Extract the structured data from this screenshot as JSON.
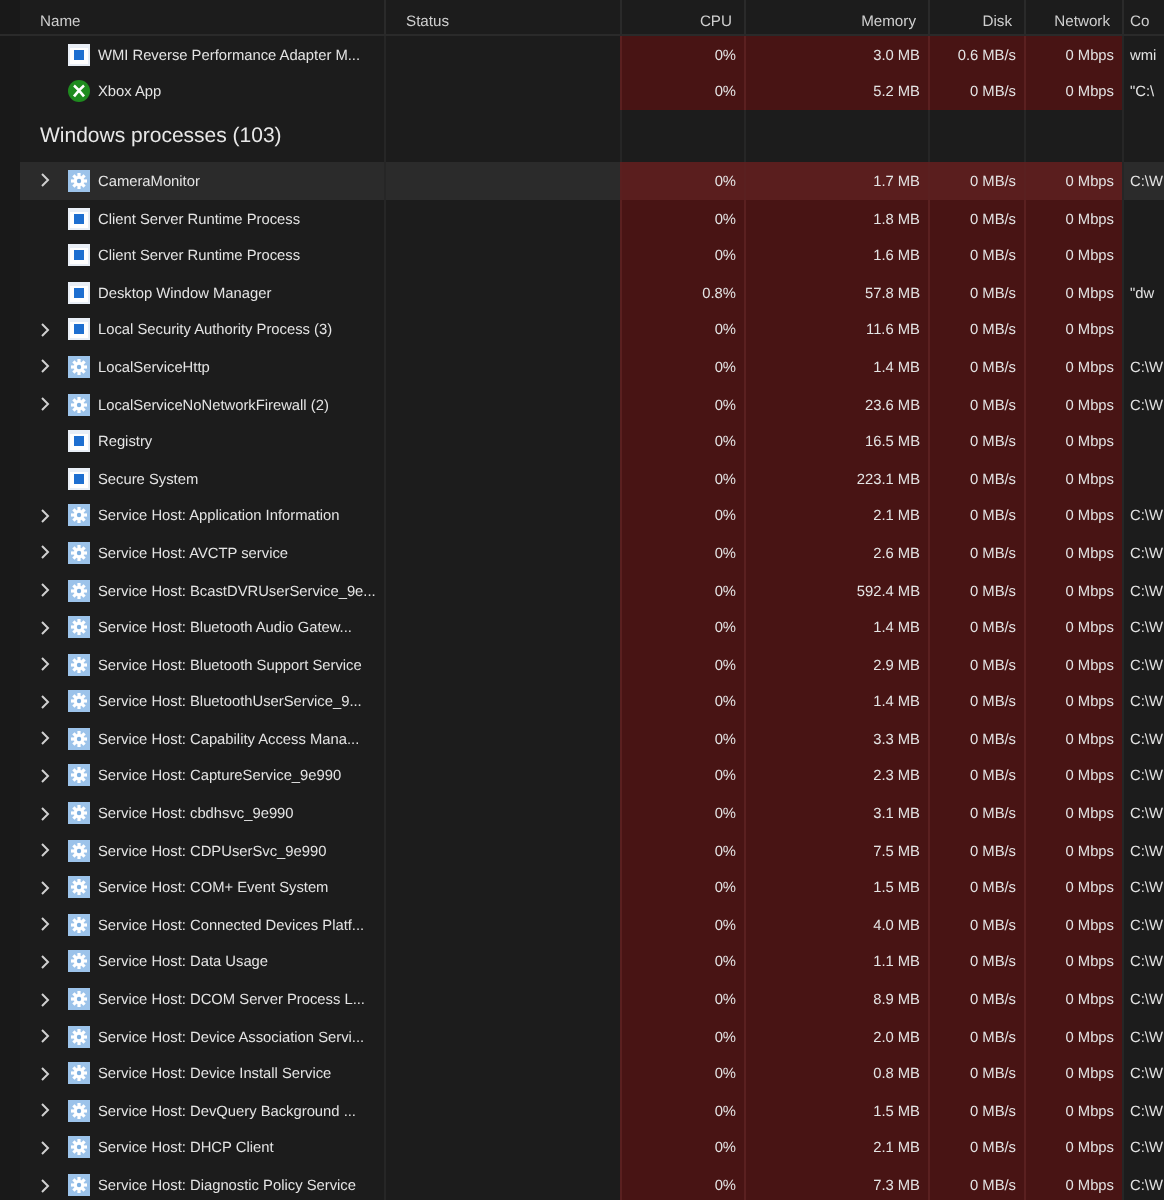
{
  "columns": [
    "Name",
    "Status",
    "CPU",
    "Memory",
    "Disk",
    "Network",
    "Co"
  ],
  "rows": [
    {
      "name": "WMI Reverse Performance Adapter M...",
      "kind": "window",
      "expandable": false,
      "selected": false,
      "cpu": "0%",
      "memory": "3.0 MB",
      "disk": "0.6 MB/s",
      "network": "0 Mbps",
      "command": "wmi"
    },
    {
      "name": "Xbox App",
      "kind": "xbox",
      "expandable": false,
      "selected": false,
      "cpu": "0%",
      "memory": "5.2 MB",
      "disk": "0 MB/s",
      "network": "0 Mbps",
      "command": "\"C:\\"
    }
  ],
  "windows_processes": {
    "heading": "Windows processes (103)",
    "rows": [
      {
        "name": "CameraMonitor",
        "kind": "gear",
        "expandable": true,
        "selected": true,
        "cpu": "0%",
        "memory": "1.7 MB",
        "disk": "0 MB/s",
        "network": "0 Mbps",
        "command": "C:\\W"
      },
      {
        "name": "Client Server Runtime Process",
        "kind": "window",
        "expandable": false,
        "selected": false,
        "cpu": "0%",
        "memory": "1.8 MB",
        "disk": "0 MB/s",
        "network": "0 Mbps"
      },
      {
        "name": "Client Server Runtime Process",
        "kind": "window",
        "expandable": false,
        "selected": false,
        "cpu": "0%",
        "memory": "1.6 MB",
        "disk": "0 MB/s",
        "network": "0 Mbps"
      },
      {
        "name": "Desktop Window Manager",
        "kind": "window",
        "expandable": false,
        "selected": false,
        "cpu": "0.8%",
        "memory": "57.8 MB",
        "disk": "0 MB/s",
        "network": "0 Mbps",
        "command": "\"dw"
      },
      {
        "name": "Local Security Authority Process (3)",
        "kind": "window",
        "expandable": true,
        "selected": false,
        "cpu": "0%",
        "memory": "11.6 MB",
        "disk": "0 MB/s",
        "network": "0 Mbps"
      },
      {
        "name": "LocalServiceHttp",
        "kind": "gear",
        "expandable": true,
        "selected": false,
        "cpu": "0%",
        "memory": "1.4 MB",
        "disk": "0 MB/s",
        "network": "0 Mbps",
        "command": "C:\\W"
      },
      {
        "name": "LocalServiceNoNetworkFirewall (2)",
        "kind": "gear",
        "expandable": true,
        "selected": false,
        "cpu": "0%",
        "memory": "23.6 MB",
        "disk": "0 MB/s",
        "network": "0 Mbps",
        "command": "C:\\W"
      },
      {
        "name": "Registry",
        "kind": "window",
        "expandable": false,
        "selected": false,
        "cpu": "0%",
        "memory": "16.5 MB",
        "disk": "0 MB/s",
        "network": "0 Mbps"
      },
      {
        "name": "Secure System",
        "kind": "window",
        "expandable": false,
        "selected": false,
        "cpu": "0%",
        "memory": "223.1 MB",
        "disk": "0 MB/s",
        "network": "0 Mbps"
      },
      {
        "name": "Service Host: Application Information",
        "kind": "gear",
        "expandable": true,
        "selected": false,
        "cpu": "0%",
        "memory": "2.1 MB",
        "disk": "0 MB/s",
        "network": "0 Mbps",
        "command": "C:\\W"
      },
      {
        "name": "Service Host: AVCTP service",
        "kind": "gear",
        "expandable": true,
        "selected": false,
        "cpu": "0%",
        "memory": "2.6 MB",
        "disk": "0 MB/s",
        "network": "0 Mbps",
        "command": "C:\\W"
      },
      {
        "name": "Service Host: BcastDVRUserService_9e...",
        "kind": "gear",
        "expandable": true,
        "selected": false,
        "cpu": "0%",
        "memory": "592.4 MB",
        "disk": "0 MB/s",
        "network": "0 Mbps",
        "command": "C:\\W"
      },
      {
        "name": "Service Host: Bluetooth Audio Gatew...",
        "kind": "gear",
        "expandable": true,
        "selected": false,
        "cpu": "0%",
        "memory": "1.4 MB",
        "disk": "0 MB/s",
        "network": "0 Mbps",
        "command": "C:\\W"
      },
      {
        "name": "Service Host: Bluetooth Support Service",
        "kind": "gear",
        "expandable": true,
        "selected": false,
        "cpu": "0%",
        "memory": "2.9 MB",
        "disk": "0 MB/s",
        "network": "0 Mbps",
        "command": "C:\\W"
      },
      {
        "name": "Service Host: BluetoothUserService_9...",
        "kind": "gear",
        "expandable": true,
        "selected": false,
        "cpu": "0%",
        "memory": "1.4 MB",
        "disk": "0 MB/s",
        "network": "0 Mbps",
        "command": "C:\\W"
      },
      {
        "name": "Service Host: Capability Access Mana...",
        "kind": "gear",
        "expandable": true,
        "selected": false,
        "cpu": "0%",
        "memory": "3.3 MB",
        "disk": "0 MB/s",
        "network": "0 Mbps",
        "command": "C:\\W"
      },
      {
        "name": "Service Host: CaptureService_9e990",
        "kind": "gear",
        "expandable": true,
        "selected": false,
        "cpu": "0%",
        "memory": "2.3 MB",
        "disk": "0 MB/s",
        "network": "0 Mbps",
        "command": "C:\\W"
      },
      {
        "name": "Service Host: cbdhsvc_9e990",
        "kind": "gear",
        "expandable": true,
        "selected": false,
        "cpu": "0%",
        "memory": "3.1 MB",
        "disk": "0 MB/s",
        "network": "0 Mbps",
        "command": "C:\\W"
      },
      {
        "name": "Service Host: CDPUserSvc_9e990",
        "kind": "gear",
        "expandable": true,
        "selected": false,
        "cpu": "0%",
        "memory": "7.5 MB",
        "disk": "0 MB/s",
        "network": "0 Mbps",
        "command": "C:\\W"
      },
      {
        "name": "Service Host: COM+ Event System",
        "kind": "gear",
        "expandable": true,
        "selected": false,
        "cpu": "0%",
        "memory": "1.5 MB",
        "disk": "0 MB/s",
        "network": "0 Mbps",
        "command": "C:\\W"
      },
      {
        "name": "Service Host: Connected Devices Platf...",
        "kind": "gear",
        "expandable": true,
        "selected": false,
        "cpu": "0%",
        "memory": "4.0 MB",
        "disk": "0 MB/s",
        "network": "0 Mbps",
        "command": "C:\\W"
      },
      {
        "name": "Service Host: Data Usage",
        "kind": "gear",
        "expandable": true,
        "selected": false,
        "cpu": "0%",
        "memory": "1.1 MB",
        "disk": "0 MB/s",
        "network": "0 Mbps",
        "command": "C:\\W"
      },
      {
        "name": "Service Host: DCOM Server Process L...",
        "kind": "gear",
        "expandable": true,
        "selected": false,
        "cpu": "0%",
        "memory": "8.9 MB",
        "disk": "0 MB/s",
        "network": "0 Mbps",
        "command": "C:\\W"
      },
      {
        "name": "Service Host: Device Association Servi...",
        "kind": "gear",
        "expandable": true,
        "selected": false,
        "cpu": "0%",
        "memory": "2.0 MB",
        "disk": "0 MB/s",
        "network": "0 Mbps",
        "command": "C:\\W"
      },
      {
        "name": "Service Host: Device Install Service",
        "kind": "gear",
        "expandable": true,
        "selected": false,
        "cpu": "0%",
        "memory": "0.8 MB",
        "disk": "0 MB/s",
        "network": "0 Mbps",
        "command": "C:\\W"
      },
      {
        "name": "Service Host: DevQuery Background ...",
        "kind": "gear",
        "expandable": true,
        "selected": false,
        "cpu": "0%",
        "memory": "1.5 MB",
        "disk": "0 MB/s",
        "network": "0 Mbps",
        "command": "C:\\W"
      },
      {
        "name": "Service Host: DHCP Client",
        "kind": "gear",
        "expandable": true,
        "selected": false,
        "cpu": "0%",
        "memory": "2.1 MB",
        "disk": "0 MB/s",
        "network": "0 Mbps",
        "command": "C:\\W"
      },
      {
        "name": "Service Host: Diagnostic Policy Service",
        "kind": "gear",
        "expandable": true,
        "selected": false,
        "cpu": "0%",
        "memory": "7.3 MB",
        "disk": "0 MB/s",
        "network": "0 Mbps",
        "command": "C:\\W"
      }
    ]
  }
}
